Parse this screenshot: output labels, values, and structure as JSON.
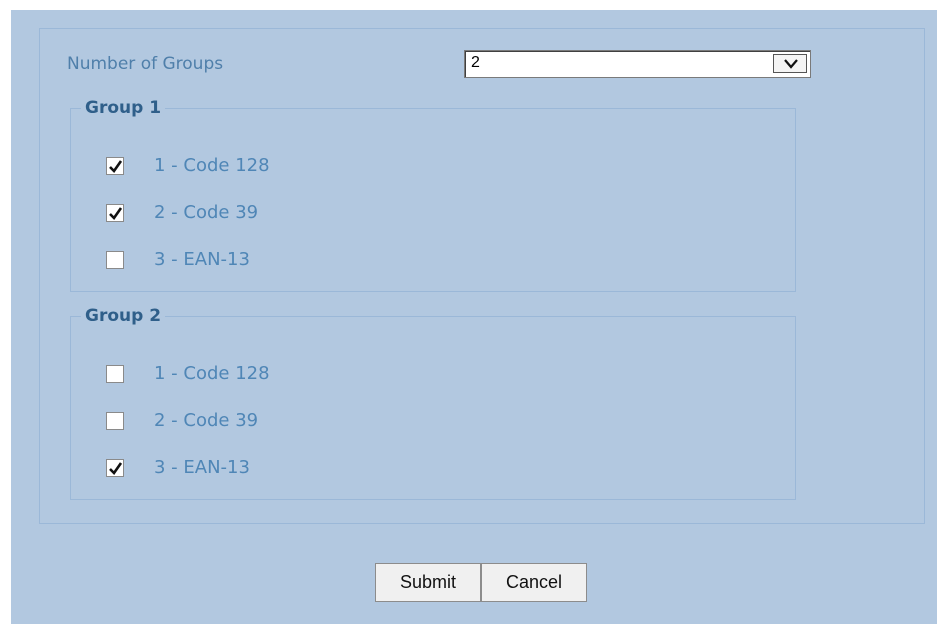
{
  "form": {
    "number_of_groups_label": "Number of Groups",
    "number_of_groups_value": "2",
    "dropdown_icon": "chevron-down-icon"
  },
  "groups": [
    {
      "title": "Group 1",
      "options": [
        {
          "label": "1 - Code 128",
          "checked": true
        },
        {
          "label": "2 - Code 39",
          "checked": true
        },
        {
          "label": "3 - EAN-13",
          "checked": false
        }
      ]
    },
    {
      "title": "Group 2",
      "options": [
        {
          "label": "1 - Code 128",
          "checked": false
        },
        {
          "label": "2 - Code 39",
          "checked": false
        },
        {
          "label": "3 - EAN-13",
          "checked": true
        }
      ]
    }
  ],
  "buttons": {
    "submit_label": "Submit",
    "cancel_label": "Cancel"
  },
  "colors": {
    "background": "#b2c8e0",
    "label_text": "#4f86b6",
    "legend_text": "#2f5f8a",
    "panel_border": "#9bb8d8"
  }
}
